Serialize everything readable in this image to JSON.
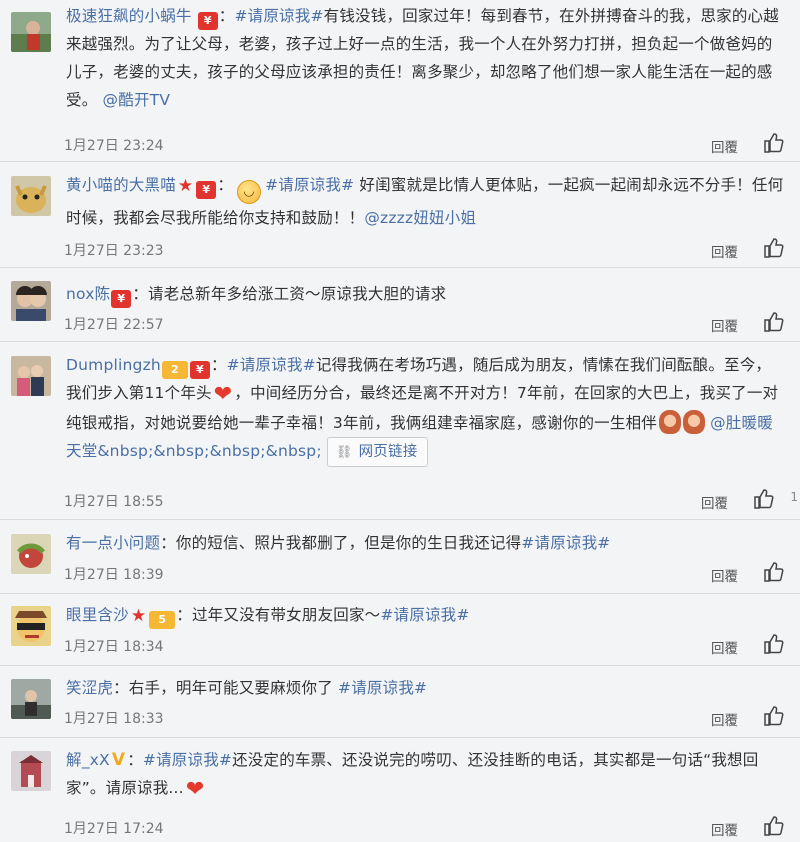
{
  "comments": [
    {
      "user": "极速狂飙的小蜗牛",
      "badge": "¥",
      "tag": "#请原谅我#",
      "text": "有钱没钱，回家过年！每到春节，在外拼搏奋斗的我，思家的心越来越强烈。为了让父母，老婆，孩子过上好一点的生活，我一个人在外努力打拼，担负起一个做爸妈的儿子，老婆的丈夫，孩子的父母应该承担的责任！离多聚少，却忽略了他们想一家人能生活在一起的感受。",
      "mention": "@酷开TV",
      "time": "1月27日 23:24",
      "reply": "回覆"
    },
    {
      "user": "黄小喵的大黑喵",
      "badge": "¥",
      "tag": "#请原谅我#",
      "text": " 好闺蜜就是比情人更体贴，一起疯一起闹却永远不分手！任何时候，我都会尽我所能给你支持和鼓励！！",
      "mention": "@zzzz妞妞小姐",
      "time": "1月27日 23:23",
      "reply": "回覆"
    },
    {
      "user": "nox陈",
      "badge": "¥",
      "text": "：请老总新年多给涨工资～原谅我大胆的请求",
      "time": "1月27日 22:57",
      "reply": "回覆"
    },
    {
      "user": "Dumplingzh",
      "vip": "2",
      "badge": "¥",
      "tag": "#请原谅我#",
      "text_a": "记得我俩在考场巧遇，随后成为朋友，情愫在我们间酝酿。至今，我们步入第11个年头",
      "text_b": "，中间经历分合，最终还是离不开对方！7年前，在回家的大巴上，我买了一对纯银戒指，对她说要给她一辈子幸福！3年前，我俩组建幸福家庭，感谢你的一生相伴",
      "mention": "@肚暖暖天堂&nbsp;&nbsp;&nbsp;&nbsp;",
      "link": "网页链接",
      "time": "1月27日 18:55",
      "reply": "回覆",
      "likes": "1"
    },
    {
      "user": "有一点小问题",
      "text": "：你的短信、照片我都删了，但是你的生日我还记得",
      "tag": "#请原谅我#",
      "time": "1月27日 18:39",
      "reply": "回覆"
    },
    {
      "user": "眼里含沙",
      "vip": "5",
      "text": "：过年又没有带女朋友回家～",
      "tag": "#请原谅我#",
      "time": "1月27日 18:34",
      "reply": "回覆"
    },
    {
      "user": "笑涩虎",
      "text": "：右手，明年可能又要麻烦你了 ",
      "tag": "#请原谅我#",
      "time": "1月27日 18:33",
      "reply": "回覆"
    },
    {
      "user": "解_xX",
      "tag": "#请原谅我#",
      "text": "还没定的车票、还没说完的唠叨、还没挂断的电话，其实都是一句话“我想回家”。请原谅我...",
      "time": "1月27日 17:24",
      "reply": "回覆"
    }
  ],
  "colors": {
    "link": "#4a6fa5",
    "badge_red": "#e2342e",
    "heart": "#e33a2d"
  }
}
